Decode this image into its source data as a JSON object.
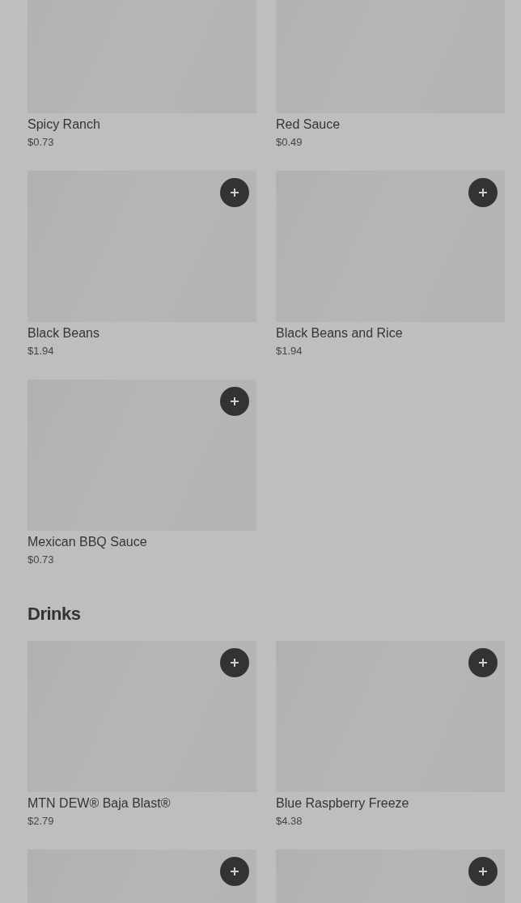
{
  "sections": [
    {
      "items": [
        {
          "kind": "cut_top",
          "name": "Spicy Ranch",
          "price": "$0.73"
        },
        {
          "kind": "cut_top",
          "name": "Red Sauce",
          "price": "$0.49"
        },
        {
          "kind": "product",
          "name": "Black Beans",
          "price": "$1.94"
        },
        {
          "kind": "product",
          "name": "Black Beans and Rice",
          "price": "$1.94"
        },
        {
          "kind": "product",
          "name": "Mexican BBQ Sauce",
          "price": "$0.73"
        }
      ]
    },
    {
      "heading": "Drinks",
      "items": [
        {
          "kind": "product",
          "name": "MTN DEW® Baja Blast®",
          "price": "$2.79"
        },
        {
          "kind": "product",
          "name": "Blue Raspberry Freeze",
          "price": "$4.38"
        },
        {
          "kind": "cut_off"
        },
        {
          "kind": "cut_off"
        }
      ]
    }
  ]
}
